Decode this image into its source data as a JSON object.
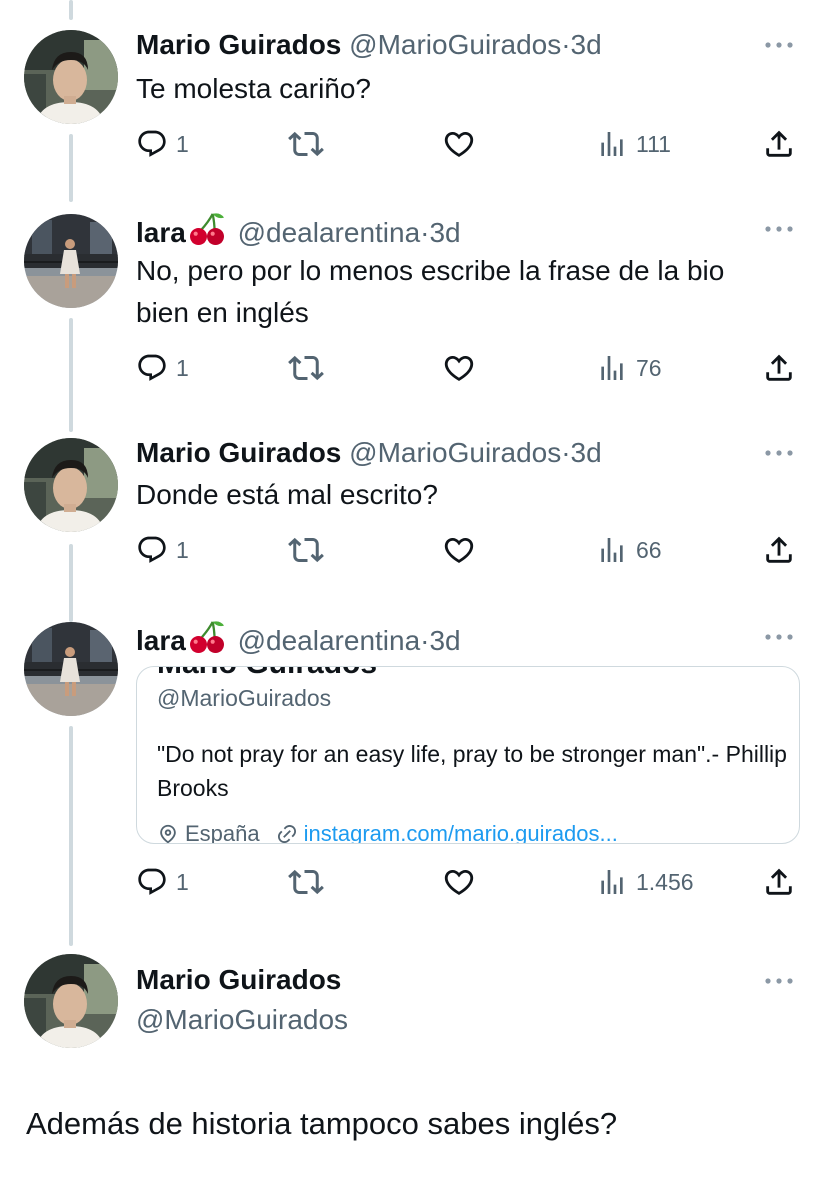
{
  "thread": [
    {
      "name": "Mario Guirados",
      "handle": "@MarioGuirados",
      "time": "3d",
      "text": "Te molesta cariño?",
      "replies": "1",
      "views": "111"
    },
    {
      "name": "lara",
      "handle": "@dealarentina",
      "time": "3d",
      "text": "No, pero por lo menos escribe la frase de la bio bien en inglés",
      "replies": "1",
      "views": "76"
    },
    {
      "name": "Mario Guirados",
      "handle": "@MarioGuirados",
      "time": "3d",
      "text": "Donde está mal escrito?",
      "replies": "1",
      "views": "66"
    },
    {
      "name": "lara",
      "handle": "@dealarentina",
      "time": "3d",
      "replies": "1",
      "views": "1.456",
      "quote": {
        "cut_name": "Mario Guirados",
        "handle": "@MarioGuirados",
        "bio": "\"Do not pray for an easy life, pray to be stronger man\".- Phillip Brooks",
        "location": "España",
        "link": "instagram.com/mario.guirados..."
      }
    }
  ],
  "main": {
    "name": "Mario Guirados",
    "handle": "@MarioGuirados",
    "text": "Además de historia tampoco sabes inglés?"
  },
  "separator": "·",
  "colors": {
    "text": "#0f1419",
    "secondary": "#536471",
    "link": "#1d9bf0",
    "thread_line": "#cfd9de",
    "cherry": "#d2002e"
  },
  "icons": [
    "reply-icon",
    "retweet-icon",
    "like-icon",
    "views-icon",
    "share-icon",
    "more-icon",
    "location-icon",
    "link-icon",
    "cherry-emoji"
  ]
}
